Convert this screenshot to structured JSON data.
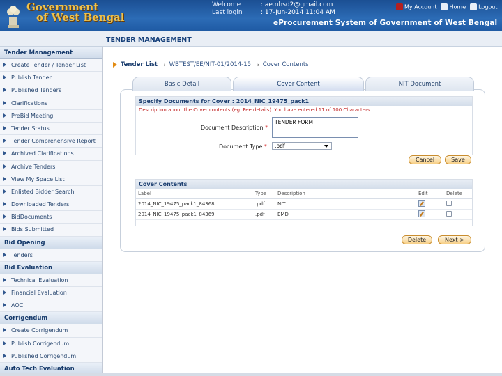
{
  "header": {
    "logo_line1": "Government",
    "logo_line2": "of West Bengal",
    "welcome_label": "Welcome",
    "last_login_label": "Last login",
    "welcome_value": ": ae.nhsd2@gmail.com",
    "last_login_value": ": 17-Jun-2014 11:04 AM",
    "links": {
      "my_account": "My Account",
      "home": "Home",
      "logout": "Logout"
    },
    "system_title": "eProcurement System of Government of West Bengal"
  },
  "page_title": "TENDER MANAGEMENT",
  "sidebar": {
    "sections": [
      {
        "title": "Tender Management",
        "items": [
          "Create Tender / Tender List",
          "Publish Tender",
          "Published Tenders",
          "Clarifications",
          "PreBid Meeting",
          "Tender Status",
          "Tender Comprehensive Report",
          "Archived Clarifications",
          "Archive Tenders",
          "View My Space List",
          "Enlisted Bidder Search",
          "Downloaded Tenders",
          "BidDocuments",
          "Bids Submitted"
        ]
      },
      {
        "title": "Bid Opening",
        "items": [
          "Tenders"
        ]
      },
      {
        "title": "Bid Evaluation",
        "items": [
          "Technical Evaluation",
          "Financial Evaluation",
          "AOC"
        ]
      },
      {
        "title": "Corrigendum",
        "items": [
          "Create Corrigendum",
          "Publish Corrigendum",
          "Published Corrigendum"
        ]
      },
      {
        "title": "Auto Tech Evaluation",
        "items": []
      }
    ]
  },
  "breadcrumb": {
    "first": "Tender List",
    "second": "WBTEST/EE/NIT-01/2014-15",
    "third": "Cover Contents"
  },
  "tabs": [
    "Basic Detail",
    "Cover Content",
    "NIT Document"
  ],
  "specify": {
    "heading": "Specify Documents for Cover : 2014_NIC_19475_pack1",
    "description": "Description about the Cover contents (eg. Fee details). You have entered 11 of 100 Characters",
    "doc_desc_label": "Document Description",
    "doc_desc_value": "TENDER FORM",
    "doc_type_label": "Document Type",
    "doc_type_value": ".pdf",
    "required_mark": "*",
    "cancel_label": "Cancel",
    "save_label": "Save"
  },
  "cover_contents": {
    "heading": "Cover Contents",
    "columns": [
      "Label",
      "Type",
      "Description",
      "Edit",
      "Delete"
    ],
    "rows": [
      {
        "label": "2014_NIC_19475_pack1_84368",
        "type": ".pdf",
        "description": "NIT"
      },
      {
        "label": "2014_NIC_19475_pack1_84369",
        "type": ".pdf",
        "description": "EMD"
      }
    ],
    "delete_label": "Delete",
    "next_label": "Next >"
  }
}
